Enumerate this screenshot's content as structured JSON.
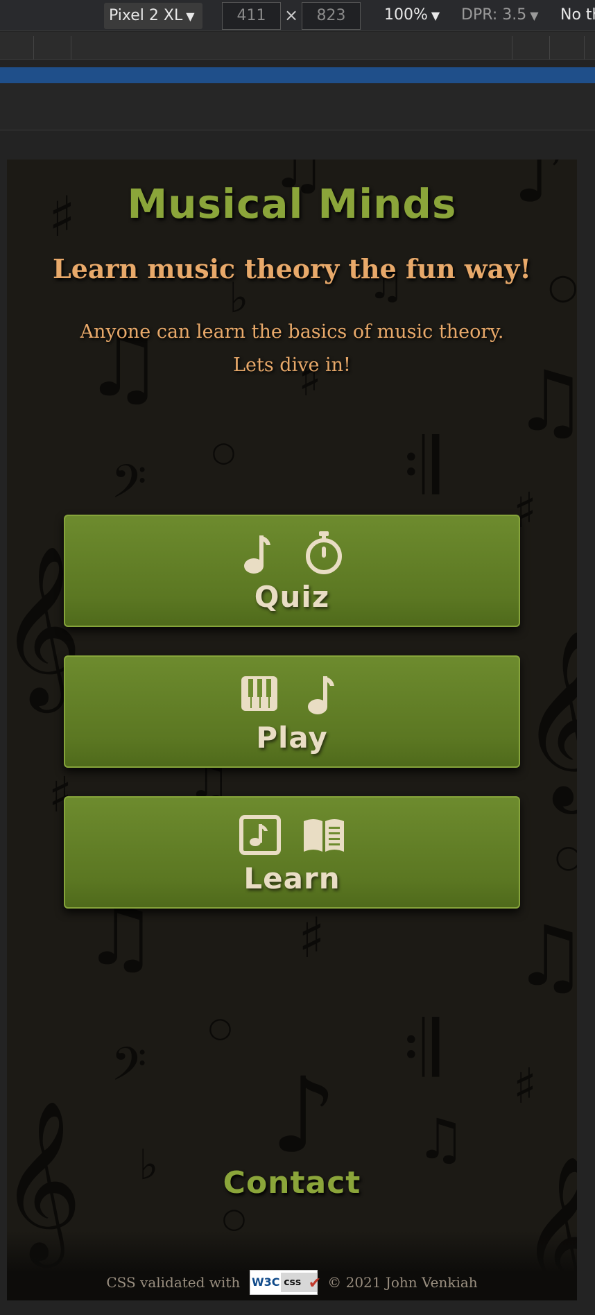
{
  "devtools": {
    "device": "Pixel 2 XL",
    "width": "411",
    "times": "×",
    "height": "823",
    "zoom": "100%",
    "dpr": "DPR: 3.5",
    "throttle": "No th",
    "dropdown_glyph": "▼"
  },
  "site": {
    "title": "Musical Minds",
    "tagline": "Learn music theory the fun way!",
    "intro": "Anyone can learn the basics of music theory. Lets dive in!"
  },
  "menu": [
    {
      "label": "Quiz",
      "icons": [
        "music-note-icon",
        "stopwatch-icon"
      ]
    },
    {
      "label": "Play",
      "icons": [
        "piano-keys-icon",
        "music-note-icon"
      ]
    },
    {
      "label": "Learn",
      "icons": [
        "music-sheet-icon",
        "open-book-icon"
      ]
    }
  ],
  "contact": "Contact",
  "footer": {
    "validated_text": "CSS validated with",
    "badge_left": "W3C",
    "badge_right": "css",
    "badge_check": "✔",
    "copyright": "© 2021 John Venkiah"
  },
  "colors": {
    "accent_green": "#8ba53a",
    "button_green": "#5b7722",
    "text_orange": "#e8a96a",
    "background": "#1c1a15"
  }
}
